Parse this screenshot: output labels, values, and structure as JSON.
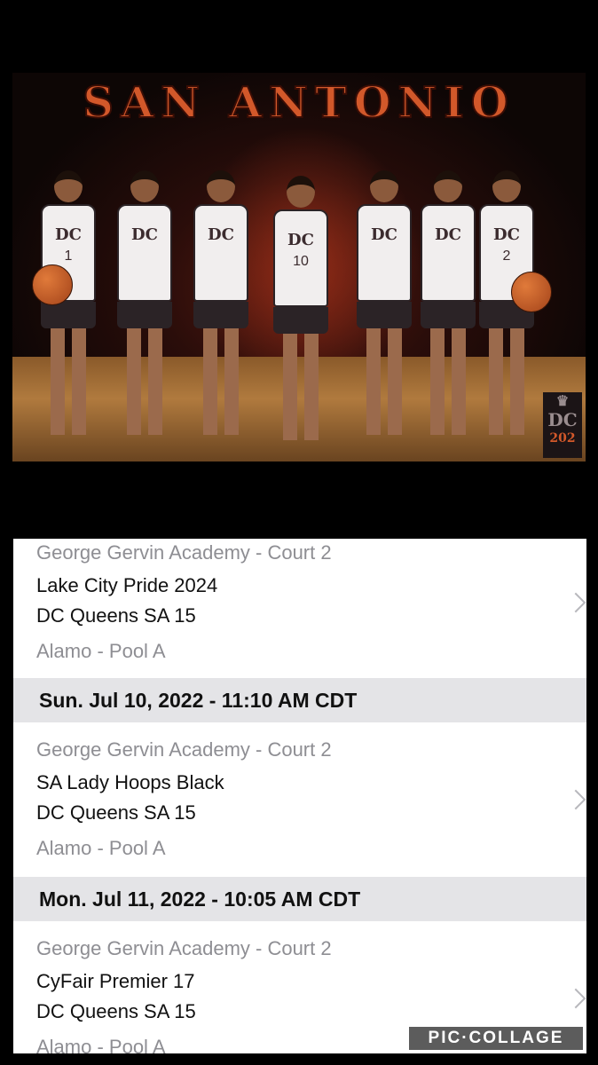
{
  "photo": {
    "title": "SAN ANTONIO",
    "team_logo_text": "DC",
    "team_logo_year": "202",
    "jersey_text": "DC",
    "jersey_numbers": [
      "1",
      "",
      "",
      "10",
      "",
      "",
      "2"
    ]
  },
  "schedule": {
    "games": [
      {
        "venue": "George Gervin Academy - Court 2",
        "team1": "Lake City Pride 2024",
        "team2": "DC Queens SA 15",
        "pool": "Alamo - Pool A"
      },
      {
        "date": "Sun. Jul 10, 2022 - 11:10 AM CDT",
        "venue": "George Gervin Academy - Court 2",
        "team1": "SA Lady Hoops Black",
        "team2": "DC Queens SA 15",
        "pool": "Alamo - Pool A"
      },
      {
        "date": "Mon. Jul 11, 2022 - 10:05 AM CDT",
        "venue": "George Gervin Academy - Court 2",
        "team1": "CyFair Premier 17",
        "team2": "DC Queens SA 15",
        "pool": "Alamo - Pool A"
      }
    ]
  },
  "watermark": "PIC·COLLAGE",
  "colors": {
    "accent": "#d2582a",
    "header_bg": "#e4e4e7",
    "muted_text": "#8e8e93"
  }
}
